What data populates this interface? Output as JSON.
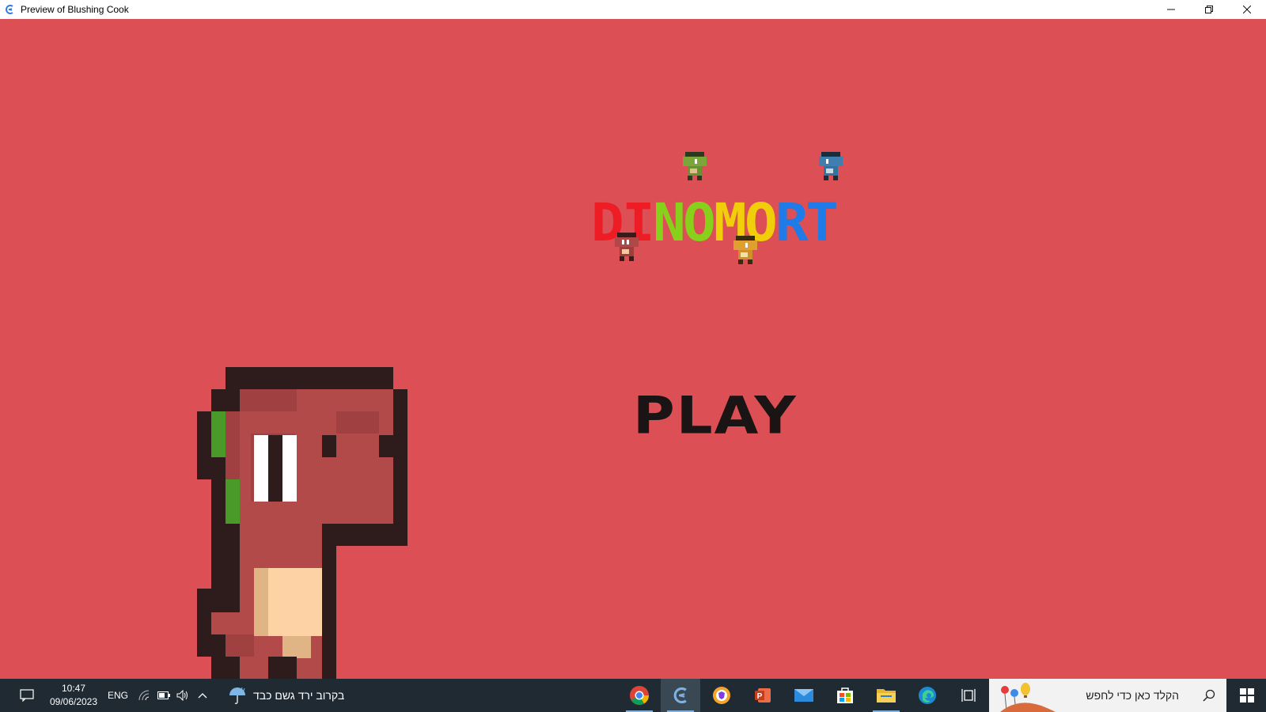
{
  "window": {
    "title": "Preview of Blushing Cook",
    "minimize_icon": "minimize-icon",
    "restore_icon": "restore-icon",
    "close_icon": "close-icon"
  },
  "game": {
    "background": "#dc4f55",
    "logo": {
      "letters": [
        {
          "char": "D",
          "color": "#ee1c24"
        },
        {
          "char": "I",
          "color": "#ee1c24"
        },
        {
          "char": "N",
          "color": "#88d11b"
        },
        {
          "char": "O",
          "color": "#88d11b"
        },
        {
          "char": "M",
          "color": "#f0cf0a"
        },
        {
          "char": "O",
          "color": "#f0cf0a"
        },
        {
          "char": "R",
          "color": "#1e7be8"
        },
        {
          "char": "T",
          "color": "#1e7be8"
        }
      ]
    },
    "play_label": "PLAY"
  },
  "taskbar": {
    "clock_time": "10:47",
    "clock_date": "09/06/2023",
    "language": "ENG",
    "weather_text": "בקרוב ירד גשם כבד",
    "search_placeholder": "הקלד כאן כדי לחפש",
    "pinned_apps": [
      "chrome-icon",
      "game-preview-icon",
      "brave-icon",
      "powerpoint-icon",
      "mail-icon",
      "store-icon",
      "file-explorer-icon",
      "edge-icon",
      "task-view-icon"
    ]
  }
}
